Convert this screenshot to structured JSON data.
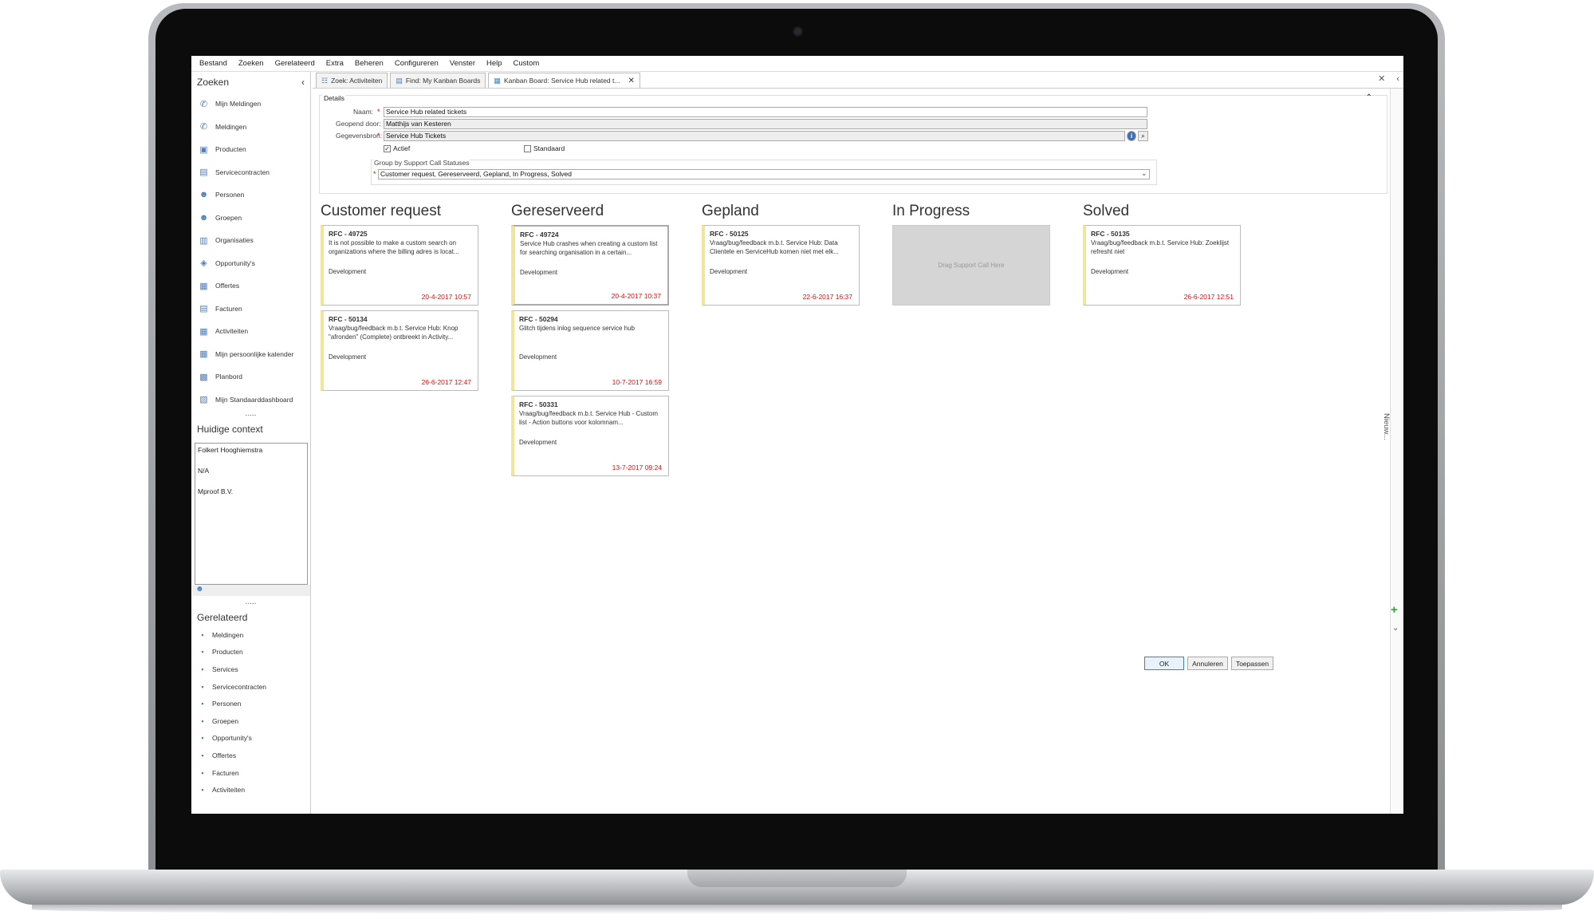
{
  "menu": [
    "Bestand",
    "Zoeken",
    "Gerelateerd",
    "Extra",
    "Beheren",
    "Configureren",
    "Venster",
    "Help",
    "Custom"
  ],
  "sidebar": {
    "title": "Zoeken",
    "collapse": "‹",
    "items": [
      {
        "label": "Mijn Meldingen",
        "icon": "phone-icon"
      },
      {
        "label": "Meldingen",
        "icon": "phone-icon"
      },
      {
        "label": "Producten",
        "icon": "product-icon"
      },
      {
        "label": "Servicecontracten",
        "icon": "document-icon"
      },
      {
        "label": "Personen",
        "icon": "person-icon"
      },
      {
        "label": "Groepen",
        "icon": "group-icon"
      },
      {
        "label": "Organisaties",
        "icon": "building-icon"
      },
      {
        "label": "Opportunity's",
        "icon": "opportunity-icon"
      },
      {
        "label": "Offertes",
        "icon": "quote-icon"
      },
      {
        "label": "Facturen",
        "icon": "invoice-icon"
      },
      {
        "label": "Activiteiten",
        "icon": "calendar-icon"
      },
      {
        "label": "Mijn persoonlijke kalender",
        "icon": "calendar-icon"
      },
      {
        "label": "Planbord",
        "icon": "planboard-icon"
      },
      {
        "label": "Mijn Standaarddashboard",
        "icon": "dashboard-icon"
      }
    ],
    "dots": ".....",
    "context_title": "Huidige context",
    "context": [
      "Folkert Hooghiemstra",
      "N/A",
      "Mproof B.V."
    ],
    "related_title": "Gerelateerd",
    "related": [
      "Meldingen",
      "Producten",
      "Services",
      "Servicecontracten",
      "Personen",
      "Groepen",
      "Opportunity's",
      "Offertes",
      "Facturen",
      "Activiteiten"
    ]
  },
  "tabs": [
    {
      "label": "Zoek: Activiteiten"
    },
    {
      "label": "Find: My Kanban Boards"
    },
    {
      "label": "Kanban Board: Service Hub related t...",
      "close": "✕"
    }
  ],
  "window_controls": {
    "close": "✕",
    "back": "‹"
  },
  "details": {
    "legend": "Details",
    "collapse": "⌃",
    "naam_label": "Naam:",
    "naam": "Service Hub related tickets",
    "geopend_label": "Geopend door:",
    "geopend": "Matthijs van Kesteren",
    "bron_label": "Gegevensbron:",
    "bron": "Service Hub Tickets",
    "actief": "Actief",
    "standaard": "Standaard",
    "group_label": "Group by Support Call Statuses",
    "group_value": "Customer request, Gereserveerd, Gepland, In Progress, Solved"
  },
  "columns": [
    {
      "title": "Customer request",
      "cards": [
        {
          "id": "RFC - 49725",
          "desc": "It is not possible to make a custom search on organizations where the billing adres is locat...",
          "team": "Development",
          "date": "20-4-2017 10:57"
        },
        {
          "id": "RFC - 50134",
          "desc": "Vraag/bug/feedback m.b.t. Service Hub: Knop \"afronden\" (Complete) ontbreekt in Activity...",
          "team": "Development",
          "date": "26-6-2017 12:47"
        }
      ]
    },
    {
      "title": "Gereserveerd",
      "cards": [
        {
          "id": "RFC - 49724",
          "desc": "Service Hub crashes when creating a custom list for searching organisation in a certain...",
          "team": "Development",
          "date": "20-4-2017 10:37"
        },
        {
          "id": "RFC - 50294",
          "desc": "Glitch tijdens inlog sequence service hub",
          "team": "Development",
          "date": "10-7-2017 16:59"
        },
        {
          "id": "RFC - 50331",
          "desc": "Vraag/bug/feedback m.b.t. Service Hub - Custom list - Action buttons voor kolomnam...",
          "team": "Development",
          "date": "13-7-2017 09:24"
        }
      ]
    },
    {
      "title": "Gepland",
      "cards": [
        {
          "id": "RFC - 50125",
          "desc": "Vraag/bug/feedback m.b.t. Service Hub: Data Clientele en ServiceHub komen niet met elk...",
          "team": "Development",
          "date": "22-6-2017 16:37"
        }
      ]
    },
    {
      "title": "In Progress",
      "cards": [],
      "drop": "Drag Support Call Here"
    },
    {
      "title": "Solved",
      "cards": [
        {
          "id": "RFC - 50135",
          "desc": "Vraag/bug/feedback m.b.t. Service Hub: Zoeklijst refresht niet",
          "team": "Development",
          "date": "26-6-2017 12:51"
        }
      ]
    }
  ],
  "side_panel_label": "Nieuw...",
  "buttons": {
    "ok": "OK",
    "cancel": "Annuleren",
    "apply": "Toepassen"
  },
  "colors": {
    "card_accent": "#f2e49a",
    "date": "#e01010",
    "icon": "#4a7fc0"
  }
}
